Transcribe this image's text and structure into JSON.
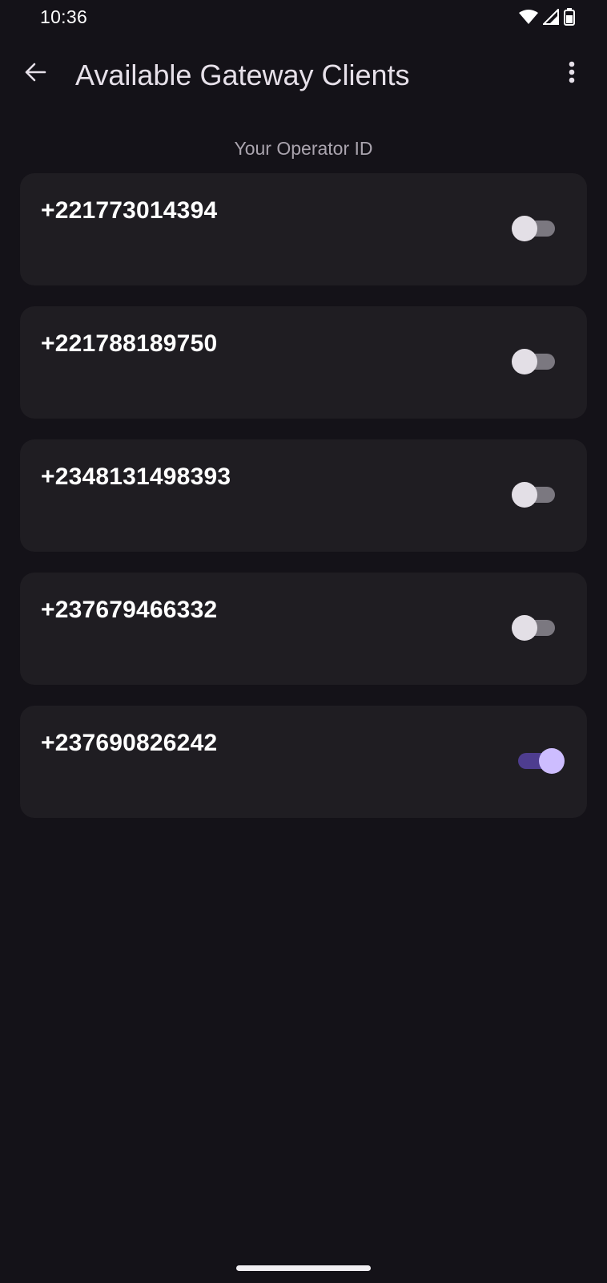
{
  "status_bar": {
    "time": "10:36",
    "icons": [
      "wifi-icon",
      "signal-icon",
      "battery-icon"
    ]
  },
  "app_bar": {
    "title": "Available Gateway Clients",
    "back_icon": "arrow-back-icon",
    "menu_icon": "more-vert-icon"
  },
  "section_label": "Your Operator ID",
  "clients": [
    {
      "number": "+221773014394",
      "enabled": false
    },
    {
      "number": "+221788189750",
      "enabled": false
    },
    {
      "number": "+2348131498393",
      "enabled": false
    },
    {
      "number": "+237679466332",
      "enabled": false
    },
    {
      "number": "+237690826242",
      "enabled": true
    }
  ],
  "colors": {
    "background": "#141218",
    "card": "#1f1d22",
    "toggle_on_track": "#4e3d8f",
    "toggle_on_thumb": "#cdbdff",
    "toggle_off_track": "#7b7880",
    "toggle_off_thumb": "#e3dfe6"
  }
}
